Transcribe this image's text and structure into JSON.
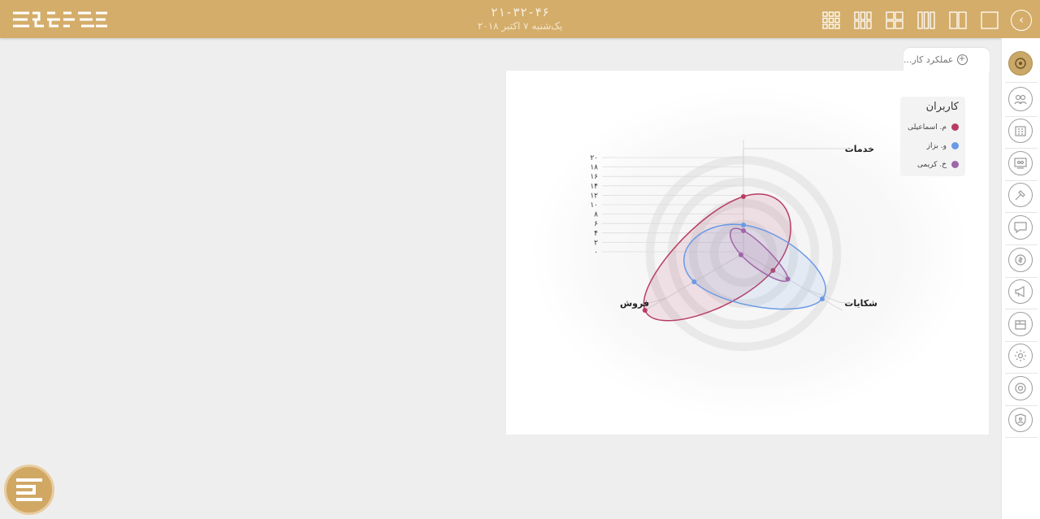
{
  "header": {
    "time": "۲۱-۳۲-۴۶",
    "date": "یک‌شنبه ۷ اکتبر ۲۰۱۸",
    "layouts": [
      "grid-3x3-icon",
      "grid-2x3-icon",
      "grid-2x2-icon",
      "columns-3-icon",
      "columns-2-icon",
      "single-pane-icon"
    ],
    "back_icon": "chevron-left-icon"
  },
  "tab": {
    "label": "عملکرد کار..."
  },
  "legend": {
    "title": "کاربران",
    "items": [
      {
        "name": "م. اسماعیلی",
        "color": "#b83d62"
      },
      {
        "name": "و. بزاز",
        "color": "#6b9ae6"
      },
      {
        "name": "خ. کریمی",
        "color": "#9f66a8"
      }
    ]
  },
  "chart_data": {
    "type": "radar",
    "axes": [
      "خدمات",
      "شکایات",
      "فروش"
    ],
    "scale_ticks": [
      "۰",
      "۲",
      "۴",
      "۶",
      "۸",
      "۱۰",
      "۱۲",
      "۱۴",
      "۱۶",
      "۱۸",
      "۲۰"
    ],
    "ylim": [
      0,
      20
    ],
    "series": [
      {
        "name": "م. اسماعیلی",
        "color": "#b83d62",
        "values": [
          10,
          6,
          20
        ]
      },
      {
        "name": "و. بزاز",
        "color": "#6b9ae6",
        "values": [
          5,
          16,
          10
        ]
      },
      {
        "name": "خ. کریمی",
        "color": "#9f66a8",
        "values": [
          4,
          9,
          0.5
        ]
      }
    ]
  },
  "sidebar": {
    "items": [
      "dashboard-icon",
      "users-icon",
      "building-icon",
      "meeting-icon",
      "hammer-icon",
      "message-icon",
      "money-icon",
      "megaphone-icon",
      "box-icon",
      "settings-icon",
      "support-icon",
      "security-icon"
    ]
  }
}
